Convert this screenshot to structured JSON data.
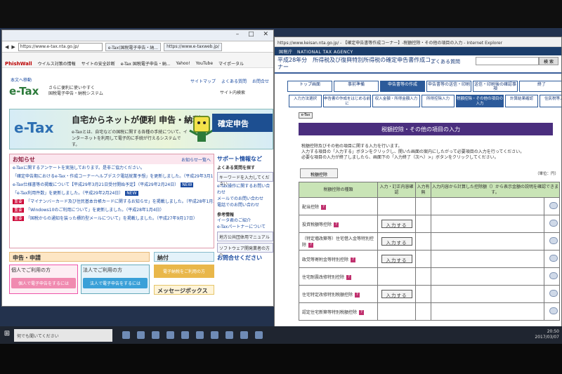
{
  "left_window": {
    "tabs": [
      "https://www.e-tax.nta.go.jp/",
      "e-Tax(国税電子申告・納...",
      "https://www.e-taxweb.jp/"
    ],
    "favorites": [
      "PhishWall",
      "ウイルス対策の情報",
      "サイトの安全診断",
      "e-Tax 国税電子申告・納...",
      "Yahoo!",
      "YouTube",
      "マイポータル"
    ],
    "page": {
      "skip_link": "本文へ移動",
      "logo": "e-Tax",
      "logo_sub": "さらに便利に使いやすく\n国税電子申告・納税システム",
      "top_links": [
        "サイトマップ",
        "よくある質問",
        "お問合せ"
      ],
      "site_search_label": "サイト内検索",
      "banner_logo": "e-Tax",
      "banner_headline": "自宅からネットが便利 申告・納税",
      "banner_body": "e-Taxとは、自宅などの国税に関する各種の手続について、インターネットを利用して電子的に手続が行えるシステムです。",
      "banner_button": "確定申告",
      "news_title": "お知らせ",
      "news_more": "お知らせ一覧へ",
      "news_items": [
        {
          "text": "e-Taxに関するアンケートを実施しております。是非ご協力ください。",
          "important": false,
          "new": false
        },
        {
          "text": "「確定申告期におけるe-Tax・作成コーナーヘルプデスク電話就業予想」を更新しました。（平成29年3月1日）",
          "important": false,
          "new": true
        },
        {
          "text": "e-Tax仕様書等の掲載について【平成29年3月21日受付開始予定】（平成29年2月24日）",
          "important": false,
          "new": true
        },
        {
          "text": "「e-Tax利用件数」を更新しました。（平成29年2月24日）",
          "important": false,
          "new": true
        },
        {
          "text": "「マイナンバーカード及び住民基本台帳カードに関するお知らせ」を掲載しました。（平成28年1月26日）",
          "important": true,
          "new": false
        },
        {
          "text": "「Windows10のご利用について」を更新しました。（平成28年1月4日）",
          "important": true,
          "new": false
        },
        {
          "text": "「国税からの通知を装った標的型メールについて」を掲載しました。（平成27年9月17日）",
          "important": true,
          "new": false
        }
      ],
      "important_label": "重要",
      "new_label": "NEW",
      "support_title": "サポート情報など",
      "faq_search_title": "よくある質問を探す",
      "keyword_placeholder": "キーワードを入力してください",
      "side_links": [
        "e-Tax操作に関するお問い合わせ",
        "メールでのお問い合わせ",
        "電話でのお問い合わせ"
      ],
      "ref_title": "参考情報",
      "ref_links": [
        "イータ君のご紹介",
        "e-Taxパートナーについて"
      ],
      "gov_links": [
        "地方公共団体用マニュアル",
        "ソフトウェア開発業者の方へ"
      ],
      "contact_title": "お問合せください",
      "apply_section": "申告・申請",
      "personal_label": "個人でご利用の方",
      "corporate_label": "法人でご利用の方",
      "personal_btn": "個人で電子申告をするには",
      "corporate_btn": "法人で電子申告をするには",
      "payment_section": "納付",
      "payment_btn": "電子納税をご利用の方",
      "message_box": "メッセージボックス"
    }
  },
  "right_window": {
    "title_bar": "https://www.keisan.nta.go.jp/ - 【確定申告書等作成コーナー】-税額控除・その他の項目の入力 - Internet Explorer",
    "agency": "国税庁　NATIONAL TAX AGENCY",
    "page_title": "平成28年分　所得税及び復興特別所得税の確定申告書作成コーナー",
    "faq_link": "よくある質問",
    "search_button": "検 索",
    "steps": [
      "トップ画面",
      "事前準備",
      "申告書等の作成",
      "申告書等の送信・印刷",
      "送信・印刷後の確認事項",
      "終了"
    ],
    "current_step": 2,
    "substeps": [
      "入力方法選択",
      "申告書の作成をはじめる前に",
      "収入金額・所得金額入力",
      "所得控除入力",
      "税額控除・その他の項目の入力",
      "計算結果確認",
      "住民税等入力",
      "住所・氏名等入力"
    ],
    "current_substep": 4,
    "small_button": "e-Tax",
    "section_title": "税額控除・その他の項目の入力",
    "instructions": [
      "税額控除及びその他の項目に関する入力を行います。",
      "入力する項目の「入力する」ボタンをクリックし、開いた画面の案内にしたがって必要項目の入力を行ってください。",
      "必要な項目の入力が終了しましたら、画面下の「入力終了（次へ）>」ボタンをクリックしてください。"
    ],
    "tax_control_button": "税額控除",
    "unit": "（単位：円）",
    "columns": [
      "税額控除の種類",
      "入力・訂正内容確認",
      "入力有無",
      "入力内容から計算した控除額（）から表示金額の説明を確認できます。"
    ],
    "rows": [
      {
        "label": "配当控除",
        "has_input": false
      },
      {
        "label": "投資税額等控除",
        "has_input": true
      },
      {
        "label": "（特定増改築等）住宅借入金等特別控除",
        "has_input": true
      },
      {
        "label": "政党等寄附金等特別控除",
        "has_input": true
      },
      {
        "label": "住宅耐震改修特別控除",
        "has_input": false
      },
      {
        "label": "住宅特定改修特別税額控除",
        "has_input": true
      },
      {
        "label": "認定住宅新築等特別税額控除",
        "has_input": false
      }
    ],
    "input_button": "入力する"
  },
  "taskbar": {
    "search_placeholder": "何でも聞いてください",
    "time": "20:50",
    "date": "2017/03/07"
  }
}
